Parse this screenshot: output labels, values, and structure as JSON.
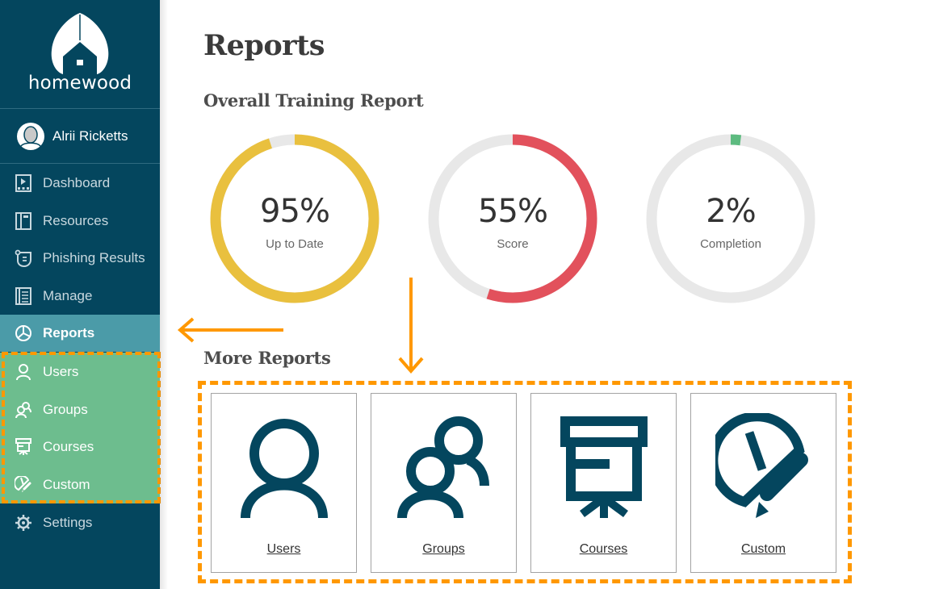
{
  "brand": {
    "name": "homewood"
  },
  "user": {
    "name": "Alrii Ricketts"
  },
  "sidebar": {
    "items": [
      {
        "label": "Dashboard",
        "icon": "dashboard-icon"
      },
      {
        "label": "Resources",
        "icon": "resources-icon"
      },
      {
        "label": "Phishing Results",
        "icon": "phishing-icon"
      },
      {
        "label": "Manage",
        "icon": "manage-icon"
      },
      {
        "label": "Reports",
        "icon": "pie-chart-icon",
        "active": true
      }
    ],
    "sub_items": [
      {
        "label": "Users",
        "icon": "user-icon"
      },
      {
        "label": "Groups",
        "icon": "groups-icon"
      },
      {
        "label": "Courses",
        "icon": "presentation-icon"
      },
      {
        "label": "Custom",
        "icon": "custom-report-icon"
      }
    ],
    "settings": {
      "label": "Settings",
      "icon": "gear-icon"
    }
  },
  "main": {
    "title": "Reports",
    "overall_title": "Overall Training Report",
    "more_title": "More Reports",
    "gauges": [
      {
        "value_text": "95%",
        "label": "Up to Date",
        "percent": 95,
        "color": "#e9c03e",
        "track": "#e8e8e8"
      },
      {
        "value_text": "55%",
        "label": "Score",
        "percent": 55,
        "color": "#e2515c",
        "track": "#e8e8e8"
      },
      {
        "value_text": "2%",
        "label": "Completion",
        "percent": 2,
        "color": "#5dbb80",
        "track": "#e8e8e8"
      }
    ],
    "report_cards": [
      {
        "label": "Users",
        "icon": "user-icon"
      },
      {
        "label": "Groups",
        "icon": "groups-icon"
      },
      {
        "label": "Courses",
        "icon": "presentation-icon"
      },
      {
        "label": "Custom",
        "icon": "custom-report-icon"
      }
    ]
  },
  "colors": {
    "sidebar_bg": "#04465e",
    "active_bg": "#4b9ba8",
    "submenu_bg": "#6dbd8e",
    "annotation": "#ff9800",
    "icon_dark": "#04465e"
  }
}
